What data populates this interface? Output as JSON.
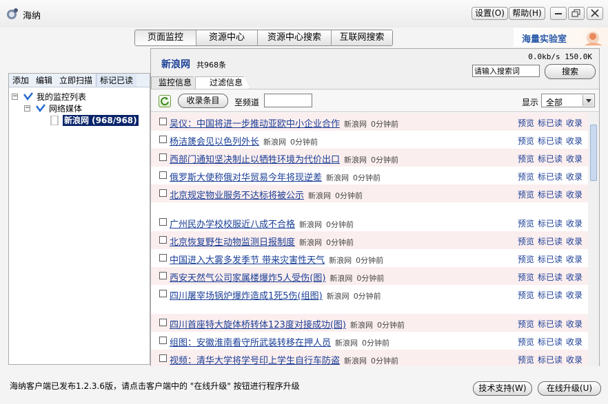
{
  "app": {
    "title": "海纳"
  },
  "titlebar": {
    "settings_label": "设置(O)",
    "help_label": "帮助(H)"
  },
  "nav": {
    "tabs": [
      {
        "label": "页面监控"
      },
      {
        "label": "资源中心"
      },
      {
        "label": "资源中心搜索"
      },
      {
        "label": "互联网搜索"
      }
    ],
    "logo_text": "海量实验室"
  },
  "left": {
    "toolbar": [
      "添加",
      "编辑",
      "立即扫描",
      "标记已读"
    ],
    "tree": {
      "root": "我的监控列表",
      "category": "网络媒体",
      "selected": "新浪网 (968/968)"
    }
  },
  "right": {
    "site_name": "新浪网",
    "site_count": "共968条",
    "speed": "0.0kb/s 150.0K",
    "search_placeholder": "请输入搜索词",
    "search_label": "搜索",
    "subtabs": [
      "监控信息",
      "过滤信息"
    ],
    "collect_label": "收录条目",
    "channel_label": "至频道",
    "display_label": "显示",
    "display_value": "全部"
  },
  "news": [
    {
      "title": "吴仪：中国将进一步推动亚欧中小企业合作",
      "source": "新浪网",
      "time": "0分钟前"
    },
    {
      "title": "杨洁篪会见以色列外长",
      "source": "新浪网",
      "time": "0分钟前"
    },
    {
      "title": "西部门通知坚决制止以牺牲环境为代价出口",
      "source": "新浪网",
      "time": "0分钟前"
    },
    {
      "title": "俄罗斯大使称俄对华贸易今年将现逆差",
      "source": "新浪网",
      "time": "0分钟前"
    },
    {
      "title": "北京规定物业服务不达标将被公示",
      "source": "新浪网",
      "time": "0分钟前"
    },
    {
      "title": "广州民办学校校服近八成不合格",
      "source": "新浪网",
      "time": "0分钟前"
    },
    {
      "title": "北京恢复野生动物监测日报制度",
      "source": "新浪网",
      "time": "0分钟前"
    },
    {
      "title": "中国进入大雾多发季节 带来灾害性天气",
      "source": "新浪网",
      "time": "0分钟前"
    },
    {
      "title": "西安天然气公司家属楼爆炸5人受伤(图)",
      "source": "新浪网",
      "time": "0分钟前"
    },
    {
      "title": "四川屠宰场锅炉爆炸造成1死5伤(组图)",
      "source": "新浪网",
      "time": "0分钟前"
    },
    {
      "title": "四川首座特大旋体桥转体123度对接成功(图)",
      "source": "新浪网",
      "time": "0分钟前"
    },
    {
      "title": "组图：安徽淮南看守所武装转移在押人员",
      "source": "新浪网",
      "time": "0分钟前"
    },
    {
      "title": "视频：清华大学将学号印上学生自行车防盗",
      "source": "新浪网",
      "time": "0分钟前"
    }
  ],
  "row_actions": {
    "preview": "预览",
    "mark": "标已读",
    "collect": "收录"
  },
  "status": {
    "text": "海纳客户端已发布1.2.3.6版，请点击客户端中的 \"在线升级\" 按钮进行程序升级",
    "support_label": "技术支持(W)",
    "upgrade_label": "在线升级(U)"
  },
  "colors": {
    "link": "#1a3e96",
    "selected": "#0a246a",
    "row_shade": "#fbeeee"
  }
}
